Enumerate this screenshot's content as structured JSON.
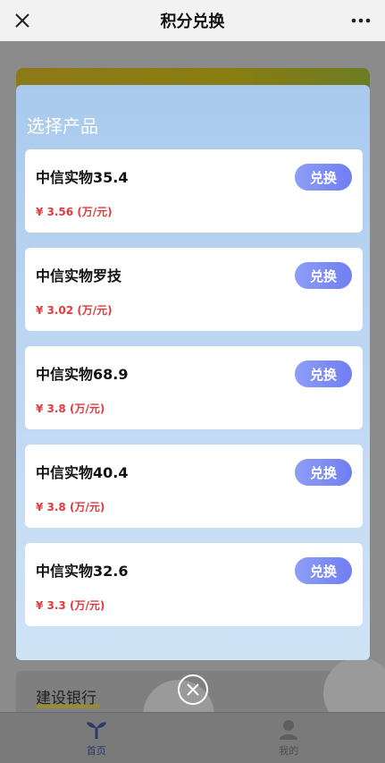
{
  "nav": {
    "title": "积分兑换"
  },
  "modal": {
    "title": "选择产品",
    "button_label": "兑换",
    "products": [
      {
        "name": "中信实物35.4",
        "price": "¥ 3.56 (万/元)"
      },
      {
        "name": "中信实物罗技",
        "price": "¥ 3.02 (万/元)"
      },
      {
        "name": "中信实物68.9",
        "price": "¥ 3.8 (万/元)"
      },
      {
        "name": "中信实物40.4",
        "price": "¥ 3.8 (万/元)"
      },
      {
        "name": "中信实物32.6",
        "price": "¥ 3.3 (万/元)"
      }
    ]
  },
  "background": {
    "card_label": "建设银行"
  },
  "tabbar": {
    "items": [
      {
        "label": "首页",
        "icon": "sprout-icon"
      },
      {
        "label": "我的",
        "icon": "user-icon"
      }
    ]
  },
  "colors": {
    "accent": "#7585f4",
    "price": "#e4393c",
    "modal_top": "#a9caee"
  }
}
